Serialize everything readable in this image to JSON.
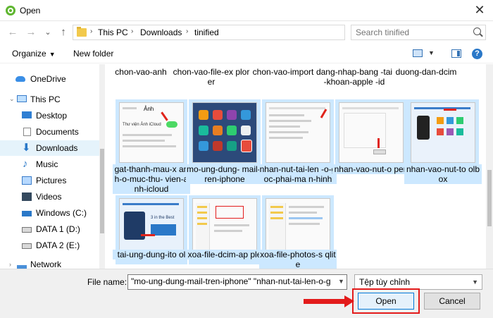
{
  "window": {
    "title": "Open",
    "close_glyph": "✕"
  },
  "nav": {
    "back": "←",
    "forward": "→",
    "recent": "⌄",
    "up": "↑"
  },
  "breadcrumb": [
    "This PC",
    "Downloads",
    "tinified"
  ],
  "search": {
    "placeholder": "Search tinified"
  },
  "toolbar": {
    "organize": "Organize",
    "new_folder": "New folder",
    "help": "?"
  },
  "sidebar": {
    "items": [
      {
        "label": "OneDrive",
        "icon": "cloud-icon"
      },
      {
        "label": "This PC",
        "icon": "computer-icon"
      },
      {
        "label": "Desktop",
        "icon": "desktop-icon"
      },
      {
        "label": "Documents",
        "icon": "documents-icon"
      },
      {
        "label": "Downloads",
        "icon": "downloads-icon",
        "selected": true
      },
      {
        "label": "Music",
        "icon": "music-icon"
      },
      {
        "label": "Pictures",
        "icon": "pictures-icon"
      },
      {
        "label": "Videos",
        "icon": "videos-icon"
      },
      {
        "label": "Windows (C:)",
        "icon": "windows-drive-icon"
      },
      {
        "label": "DATA 1 (D:)",
        "icon": "drive-icon"
      },
      {
        "label": "DATA 2 (E:)",
        "icon": "drive-icon"
      },
      {
        "label": "Network",
        "icon": "network-icon"
      }
    ]
  },
  "files_top_row": [
    "chon-vao-anh",
    "chon-vao-file-ex plorer",
    "chon-vao-import",
    "dang-nhap-bang -tai-khoan-apple -id",
    "duong-dan-dcim"
  ],
  "files": [
    {
      "name": "gat-thanh-mau-x anh-o-muc-thu- vien-anh-icloud",
      "selected": true
    },
    {
      "name": "mo-ung-dung- mail-tren-iphone",
      "selected": true
    },
    {
      "name": "nhan-nut-tai-len -o-goc-phai-ma n-hinh",
      "selected": true
    },
    {
      "name": "nhan-vao-nut-o pen",
      "selected": true
    },
    {
      "name": "nhan-vao-nut-to olbox",
      "selected": true
    },
    {
      "name": "tai-ung-dung-ito ol",
      "selected": true
    },
    {
      "name": "xoa-file-dcim-ap ple",
      "selected": true
    },
    {
      "name": "xoa-file-photos-s qlite",
      "selected": true
    }
  ],
  "thumb_text": {
    "icloud_header": "Ảnh",
    "icloud_row": "Thư viện Ảnh iCloud",
    "itool_text": "3 in the Best"
  },
  "bottom": {
    "filename_label": "File name:",
    "filename_value": "\"mo-ung-dung-mail-tren-iphone\" \"nhan-nut-tai-len-o-g",
    "file_type": "Tệp tùy chỉnh",
    "open_label": "Open",
    "cancel_label": "Cancel"
  },
  "colors": {
    "accent": "#0078d7",
    "selection": "#cce8ff",
    "annotation_red": "#e31b1b"
  }
}
